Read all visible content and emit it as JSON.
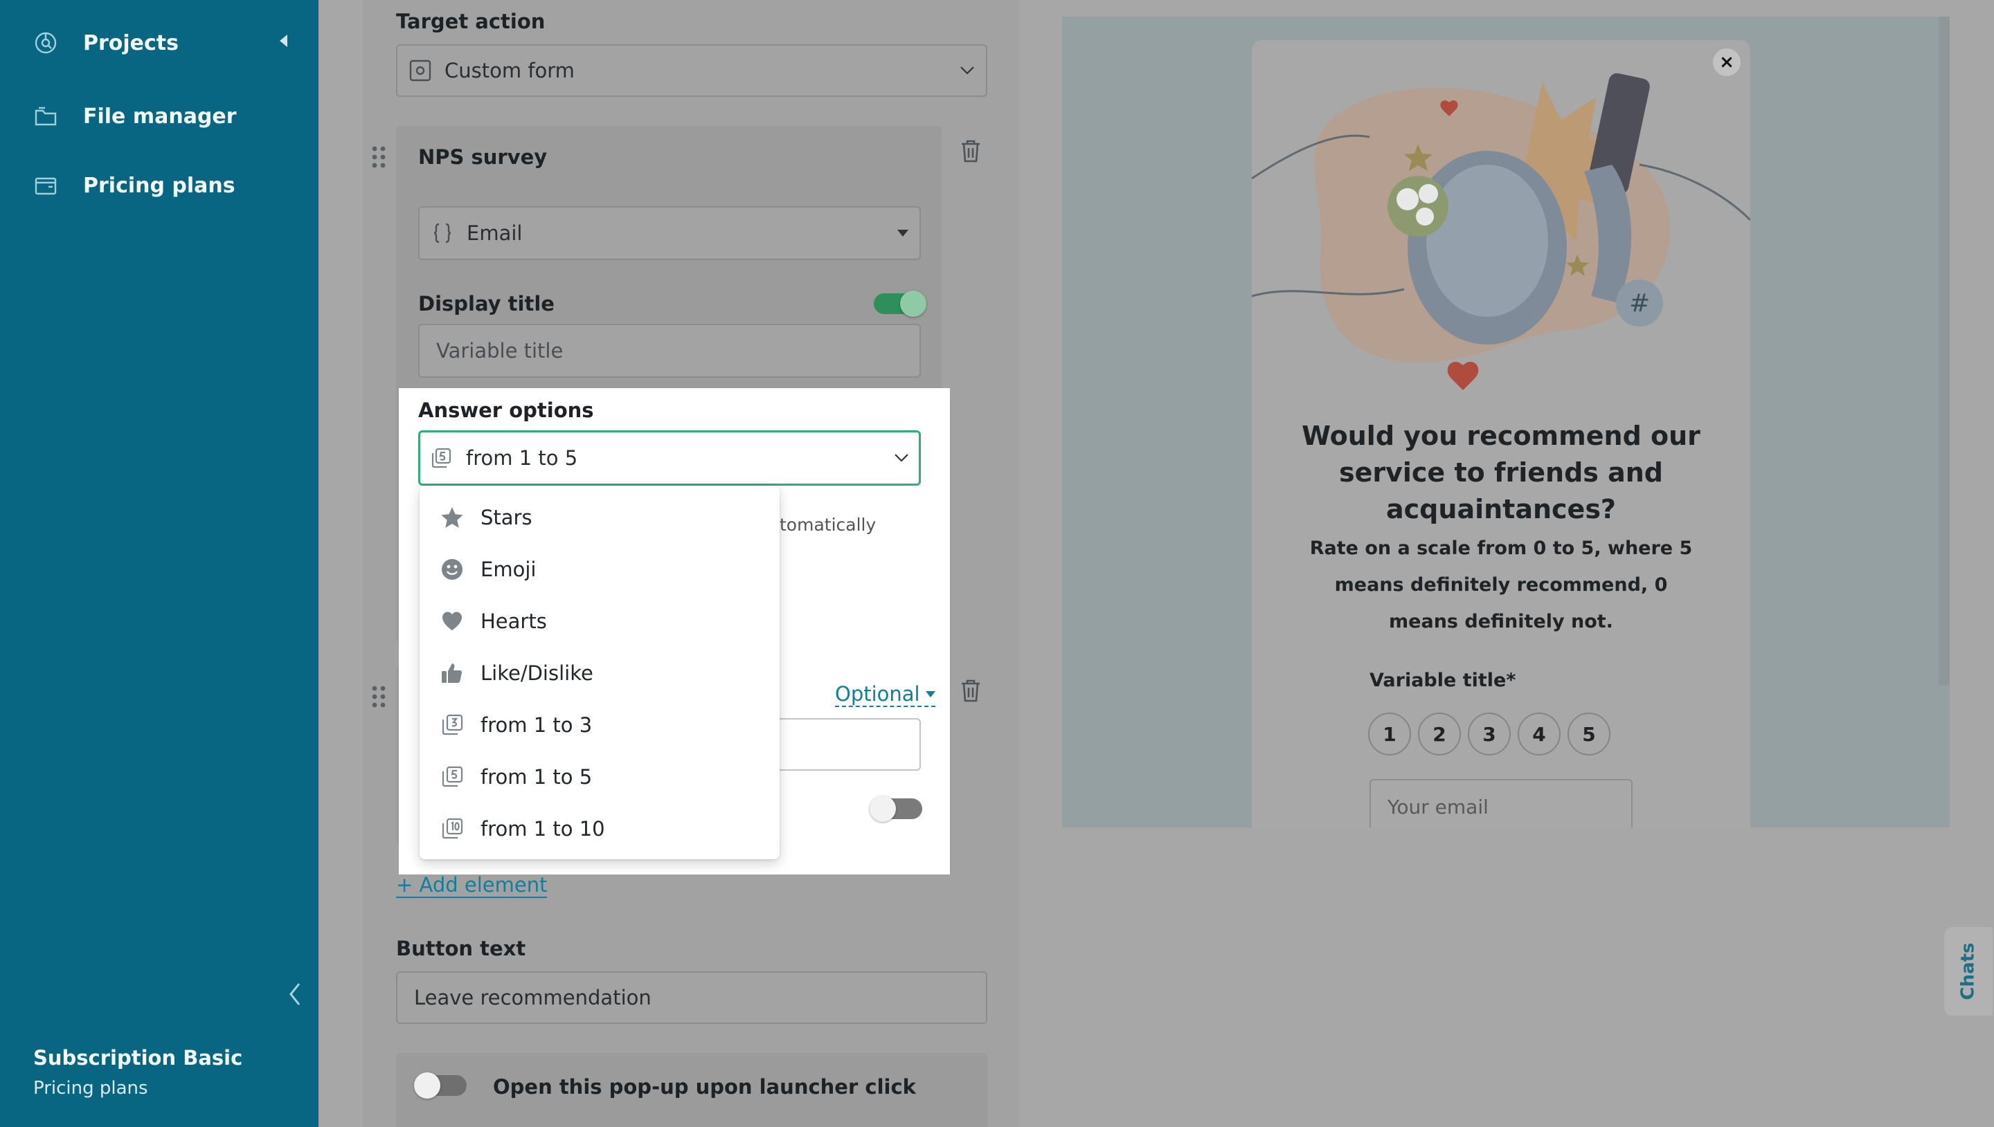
{
  "sidebar": {
    "items": [
      {
        "label": "Projects",
        "icon": "projects-icon"
      },
      {
        "label": "File manager",
        "icon": "folder-icon"
      },
      {
        "label": "Pricing plans",
        "icon": "wallet-icon"
      }
    ],
    "subscription_name": "Subscription Basic",
    "subscription_link": "Pricing plans"
  },
  "settings": {
    "target_action_label": "Target action",
    "target_action_value": "Custom form",
    "nps_title": "NPS survey",
    "variable_value": "Email",
    "display_title_label": "Display title",
    "display_title_on": true,
    "variable_title_placeholder": "Variable title",
    "answer_options_label": "Answer options",
    "answer_options_value": "from 1 to 5",
    "partial_text": "tomatically",
    "optional_label": "Optional",
    "add_element": "+ Add element",
    "button_text_label": "Button text",
    "button_text_value": "Leave recommendation",
    "launcher_label": "Open this pop-up upon launcher click"
  },
  "dropdown": {
    "options": [
      {
        "label": "Stars",
        "icon": "star-icon"
      },
      {
        "label": "Emoji",
        "icon": "emoji-icon"
      },
      {
        "label": "Hearts",
        "icon": "heart-icon"
      },
      {
        "label": "Like/Dislike",
        "icon": "thumbs-up-icon"
      },
      {
        "label": "from 1 to 3",
        "icon": "number-3-icon"
      },
      {
        "label": "from 1 to 5",
        "icon": "number-5-icon"
      },
      {
        "label": "from 1 to 10",
        "icon": "number-10-icon"
      }
    ]
  },
  "preview": {
    "title": "Would you recommend our service to friends and acquaintances?",
    "subtitle": "Rate on a scale from 0 to 5, where 5 means definitely recommend, 0 means definitely not.",
    "field_label": "Variable title*",
    "ratings": [
      "1",
      "2",
      "3",
      "4",
      "5"
    ],
    "email_placeholder": "Your email",
    "close_symbol": "×"
  },
  "chats_label": "Chats",
  "colors": {
    "sidebar_bg": "#086682",
    "accent_green": "#2fae78",
    "link_teal": "#0f7fa0"
  }
}
